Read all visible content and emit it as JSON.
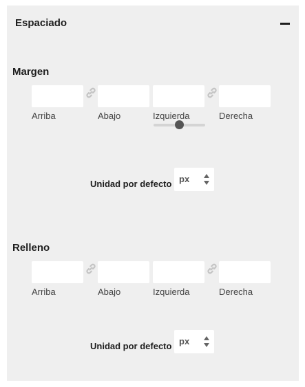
{
  "panel": {
    "title": "Espaciado",
    "collapse_icon": "minus-icon"
  },
  "margin": {
    "title": "Margen",
    "fields": [
      {
        "label": "Arriba",
        "value": ""
      },
      {
        "label": "Abajo",
        "value": ""
      },
      {
        "label": "Izquierda",
        "value": ""
      },
      {
        "label": "Derecha",
        "value": ""
      }
    ],
    "link_icon": "link-icon",
    "slider_level_percent": 50,
    "unit": {
      "label": "Unidad por defecto",
      "value": "px",
      "icon": "up-down-arrows-icon"
    }
  },
  "padding": {
    "title": "Relleno",
    "fields": [
      {
        "label": "Arriba",
        "value": ""
      },
      {
        "label": "Abajo",
        "value": ""
      },
      {
        "label": "Izquierda",
        "value": ""
      },
      {
        "label": "Derecha",
        "value": ""
      }
    ],
    "link_icon": "link-icon",
    "unit": {
      "label": "Unidad por defecto",
      "value": "px",
      "icon": "up-down-arrows-icon"
    }
  },
  "colors": {
    "panel_bg": "#efefef",
    "input_bg": "#ffffff",
    "text": "#1e1e1e",
    "muted_text": "#444444",
    "link_icon": "#c4c4c4",
    "slider_thumb": "#555555"
  }
}
